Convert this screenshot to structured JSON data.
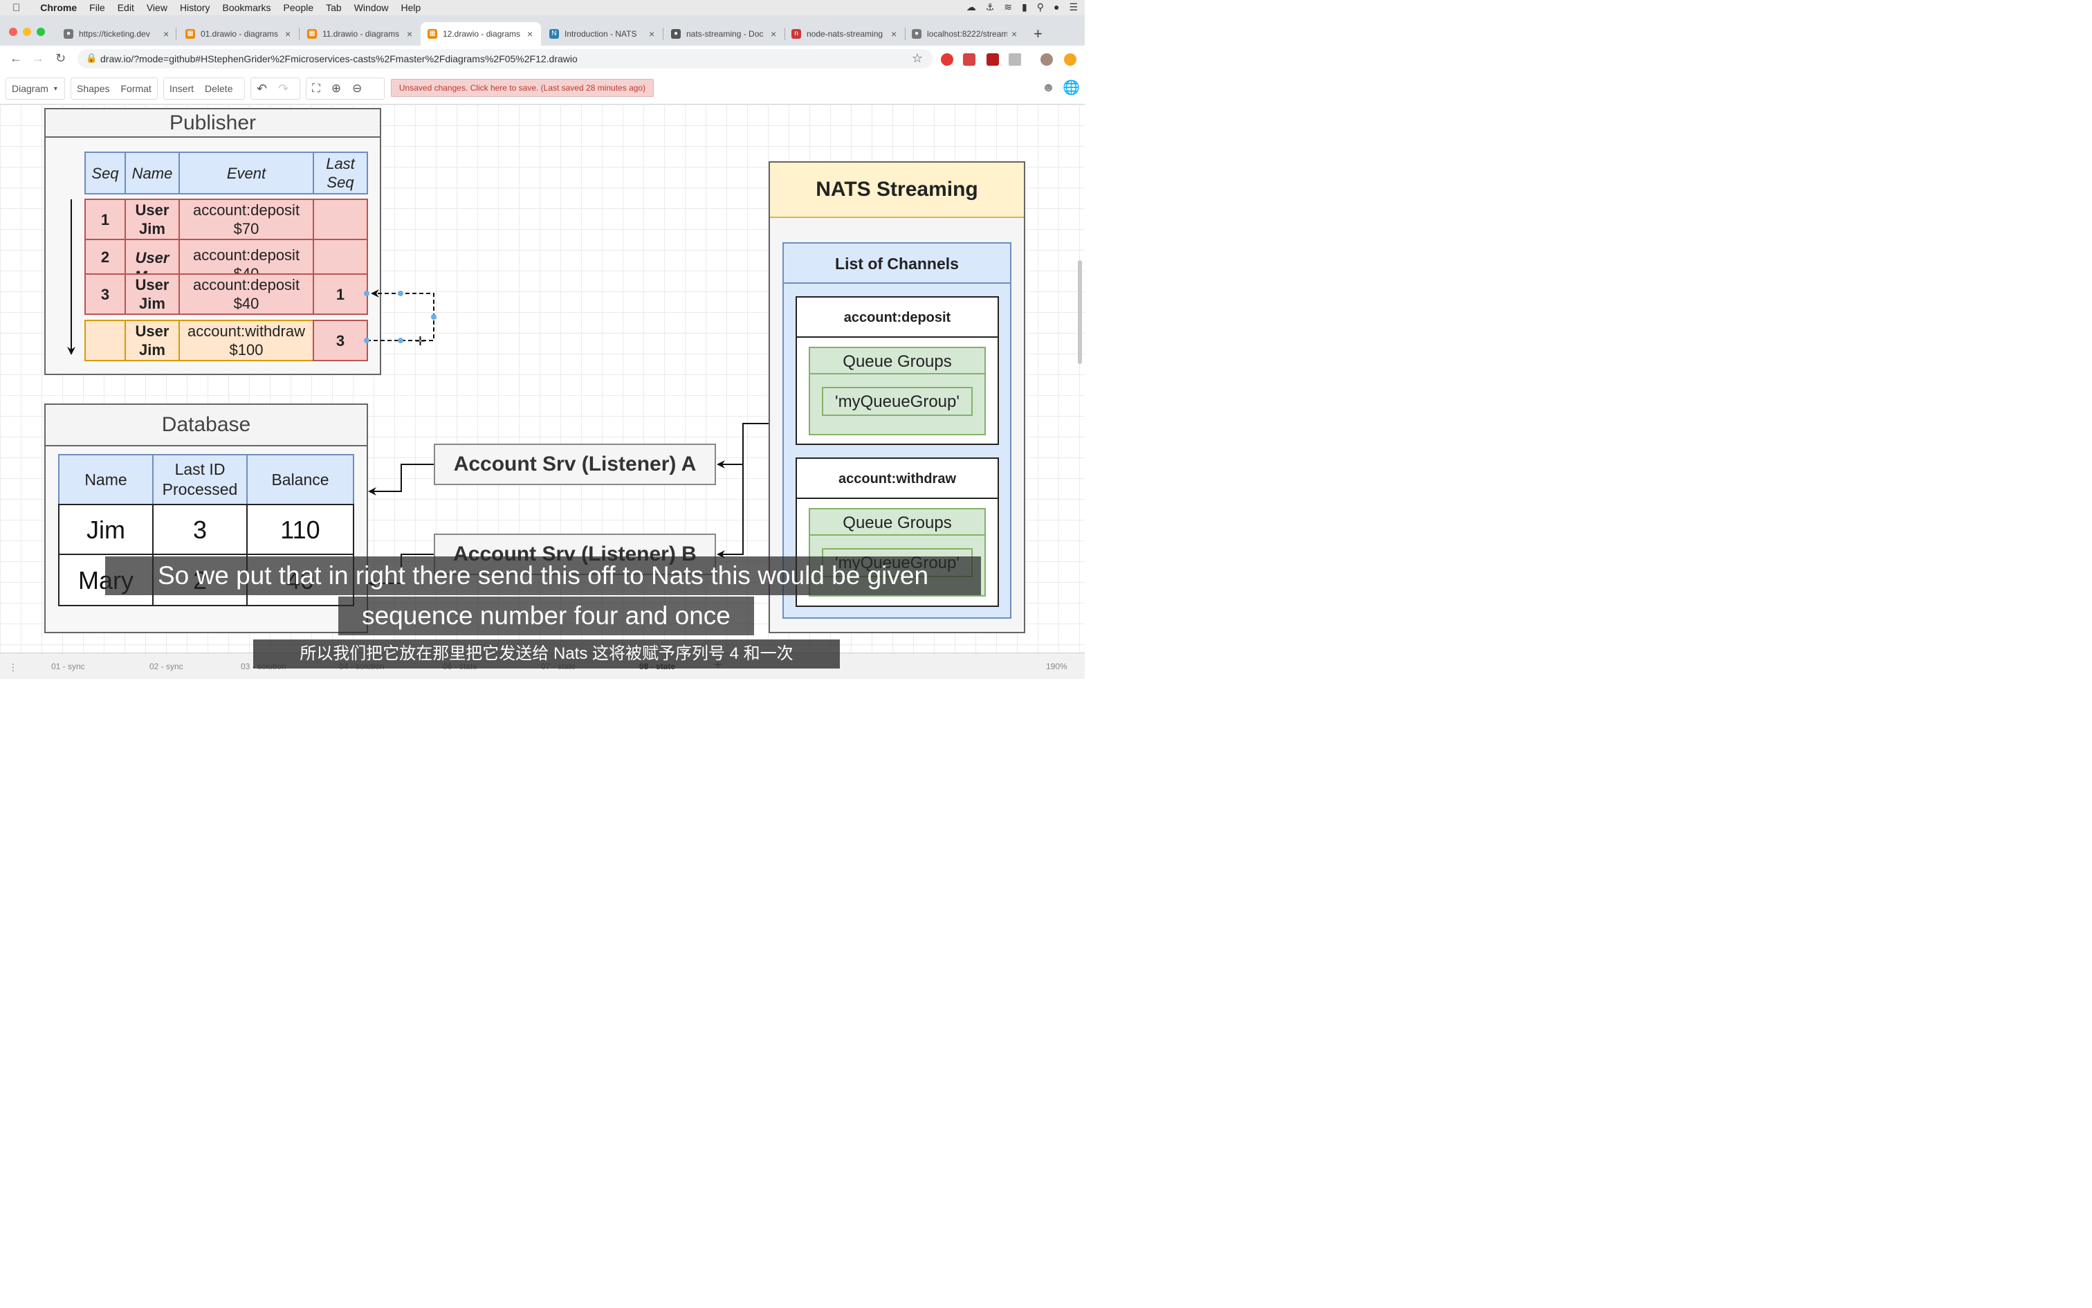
{
  "menubar": {
    "app": "Chrome",
    "items": [
      "File",
      "Edit",
      "View",
      "History",
      "Bookmarks",
      "People",
      "Tab",
      "Window",
      "Help"
    ]
  },
  "tabs": [
    {
      "title": "https://ticketing.dev",
      "active": false
    },
    {
      "title": "01.drawio - diagrams",
      "active": false
    },
    {
      "title": "11.drawio - diagrams",
      "active": false
    },
    {
      "title": "12.drawio - diagrams",
      "active": true
    },
    {
      "title": "Introduction - NATS",
      "active": false
    },
    {
      "title": "nats-streaming - Doc",
      "active": false
    },
    {
      "title": "node-nats-streaming",
      "active": false
    },
    {
      "title": "localhost:8222/streaming",
      "active": false
    }
  ],
  "address": {
    "url": "draw.io/?mode=github#HStephenGrider%2Fmicroservices-casts%2Fmaster%2Fdiagrams%2F05%2F12.drawio"
  },
  "toolbar": {
    "diagram": "Diagram",
    "shapes": "Shapes",
    "format": "Format",
    "insert": "Insert",
    "delete": "Delete",
    "unsaved": "Unsaved changes. Click here to save. (Last saved 28 minutes ago)"
  },
  "publisher": {
    "title": "Publisher",
    "headers": {
      "seq": "Seq",
      "name": "Name",
      "event": "Event",
      "last_seq": "Last Seq"
    },
    "rows": [
      {
        "seq": "1",
        "name": "User Jim",
        "event": "account:deposit $70",
        "last_seq": ""
      },
      {
        "seq": "2",
        "name": "User Mary",
        "event": "account:deposit $40",
        "last_seq": ""
      },
      {
        "seq": "3",
        "name": "User Jim",
        "event": "account:deposit $40",
        "last_seq": "1"
      },
      {
        "seq": "",
        "name": "User Jim",
        "event": "account:withdraw $100",
        "last_seq": "3"
      }
    ]
  },
  "database": {
    "title": "Database",
    "headers": {
      "name": "Name",
      "last_id": "Last ID Processed",
      "balance": "Balance"
    },
    "rows": [
      {
        "name": "Jim",
        "last_id": "3",
        "balance": "110"
      },
      {
        "name": "Mary",
        "last_id": "2",
        "balance": "40"
      }
    ]
  },
  "listeners": {
    "a": "Account Srv (Listener) A",
    "b": "Account Srv (Listener) B"
  },
  "nats": {
    "title": "NATS Streaming",
    "list_title": "List of Channels",
    "channels": [
      {
        "name": "account:deposit",
        "groups_label": "Queue Groups",
        "group": "'myQueueGroup'"
      },
      {
        "name": "account:withdraw",
        "groups_label": "Queue Groups",
        "group": "'myQueueGroup'"
      }
    ]
  },
  "pages": [
    {
      "label": "01 - sync"
    },
    {
      "label": "02 - sync"
    },
    {
      "label": "03 - solution"
    },
    {
      "label": "04 - solution"
    },
    {
      "label": "06 - state"
    },
    {
      "label": "07 - state"
    },
    {
      "label": "08 - state",
      "active": true
    }
  ],
  "zoom": "190%",
  "subtitles": {
    "line1": "So we put that in right there send this off to Nats this would be given",
    "line2": "sequence number four and once",
    "cn": "所以我们把它放在那里把它发送给 Nats 这将被赋予序列号 4 和一次"
  },
  "colors": {
    "header_blue": "#dae8fc",
    "event_red": "#f8cecc",
    "event_orange": "#ffe6cc",
    "nats_yellow": "#fff2cc",
    "queue_green": "#d5e8d4",
    "unsaved_red": "#c0392b"
  }
}
